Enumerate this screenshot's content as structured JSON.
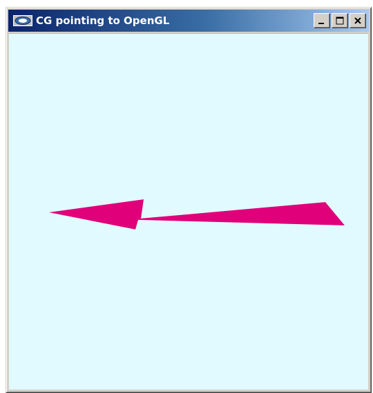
{
  "window": {
    "title": "CG pointing to OpenGL",
    "icon": "application-icon"
  },
  "caption_buttons": [
    {
      "name": "minimize-button",
      "icon": "minimize-icon"
    },
    {
      "name": "maximize-button",
      "icon": "maximize-icon"
    },
    {
      "name": "close-button",
      "icon": "close-icon"
    }
  ],
  "canvas": {
    "background_color": "#e0faff",
    "arrow_color": "#e0007a",
    "arrow_direction": "left"
  }
}
